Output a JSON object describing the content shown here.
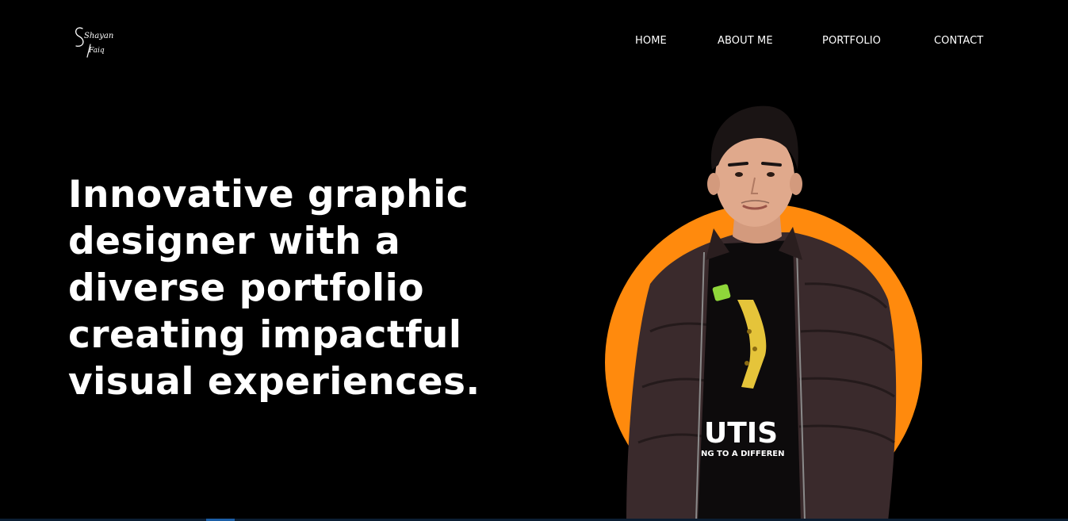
{
  "brand": {
    "logo_line1": "Shayan",
    "logo_line2": "Faiq"
  },
  "nav": {
    "items": [
      {
        "label": "HOME"
      },
      {
        "label": "ABOUT ME"
      },
      {
        "label": "PORTFOLIO"
      },
      {
        "label": "CONTACT"
      }
    ]
  },
  "hero": {
    "headline": "Innovative graphic designer with a diverse portfolio creating impactful visual experiences.",
    "portrait": {
      "icon": "person-portrait",
      "shirt_text_1": "UTIS",
      "shirt_text_2": "NG TO A DIFFEREN"
    }
  },
  "colors": {
    "background": "#000000",
    "text": "#ffffff",
    "accent_circle": "#ff8a0d",
    "jacket": "#3a2a2c",
    "skin": "#e0a98c",
    "hair": "#1a1414"
  }
}
